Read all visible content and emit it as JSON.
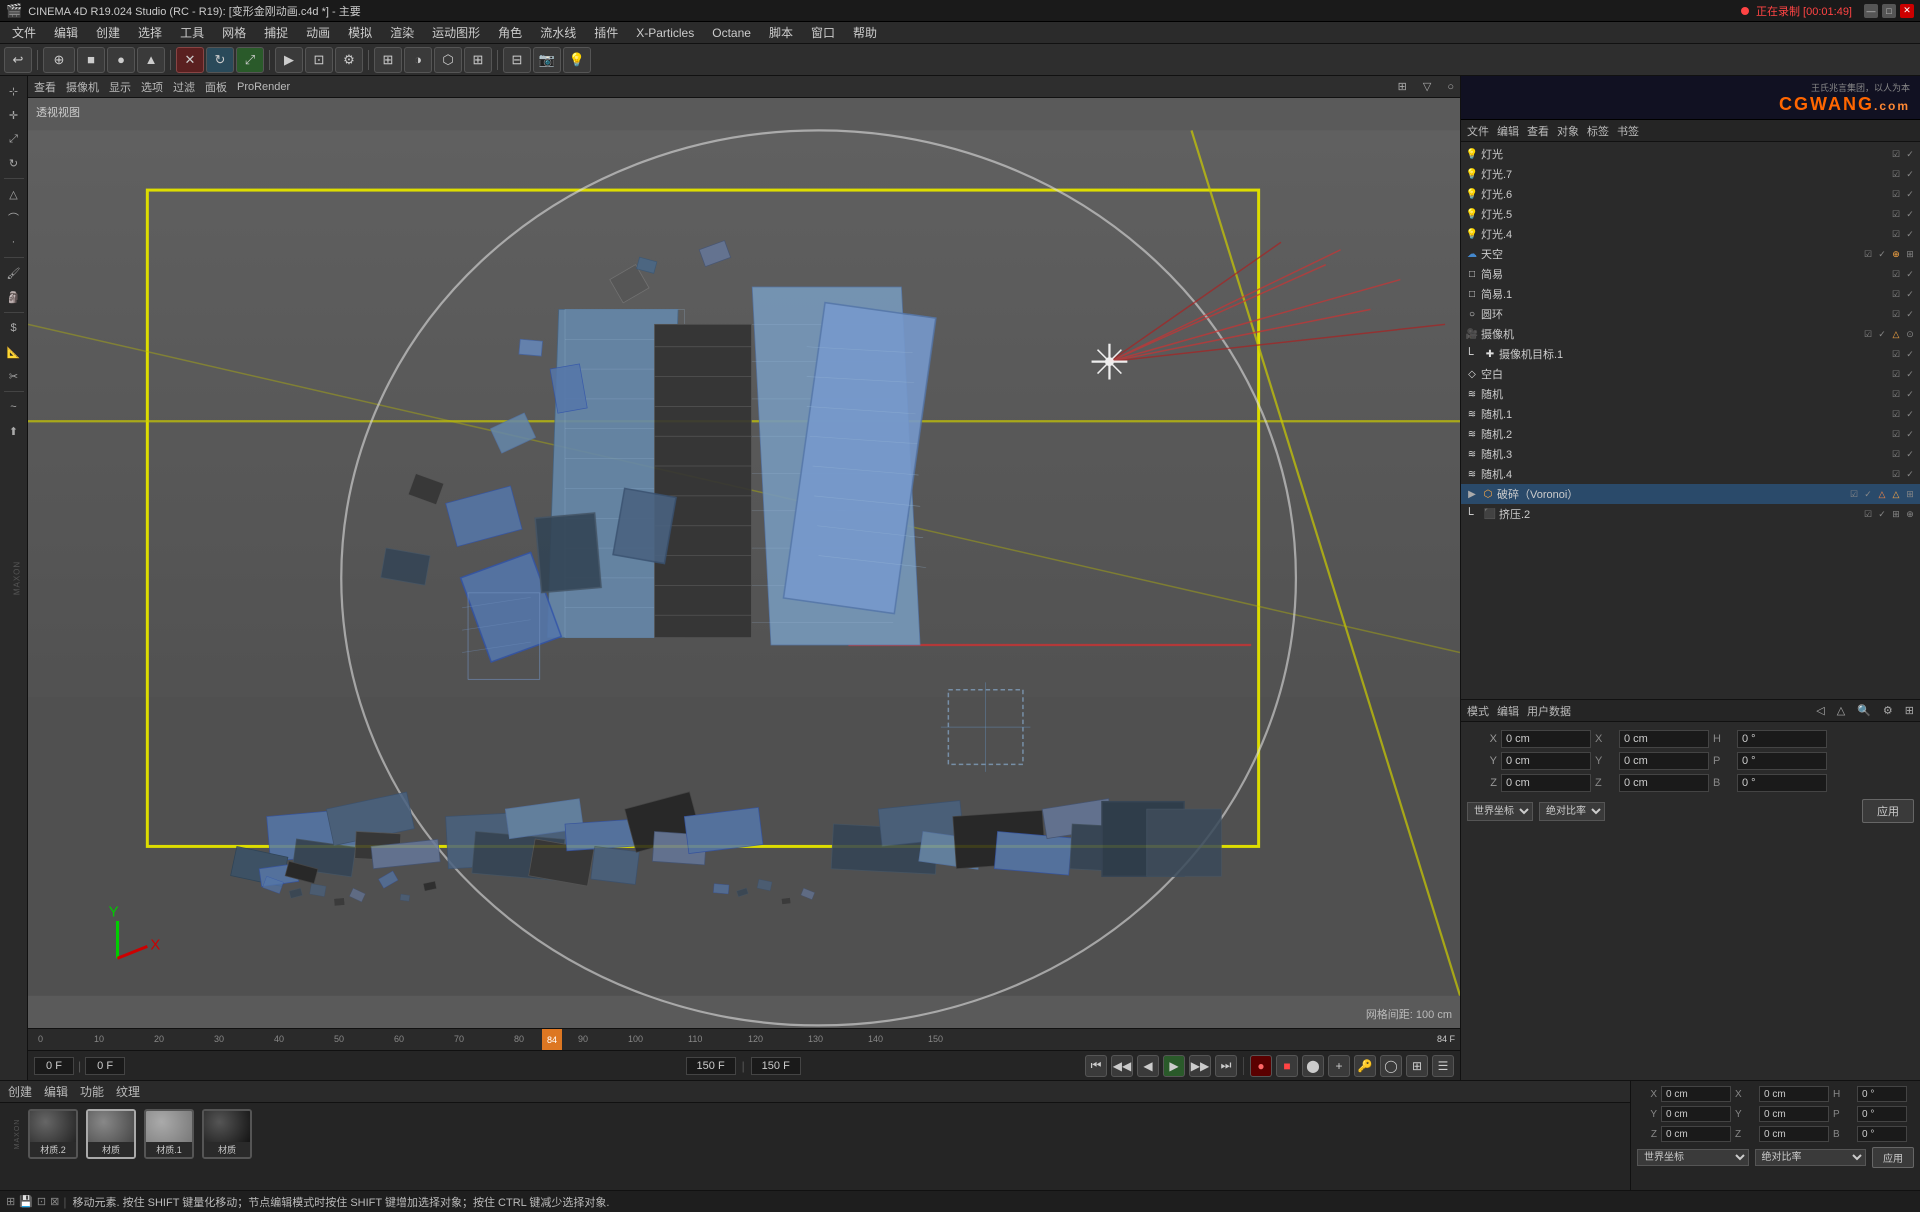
{
  "titleBar": {
    "title": "CINEMA 4D R19.024 Studio (RC - R19): [变形金刚动画.c4d *] - 主要",
    "recording": "正在录制 [00:01:49]"
  },
  "menuBar": {
    "items": [
      "文件",
      "编辑",
      "创建",
      "选择",
      "工具",
      "网格",
      "捕捉",
      "动画",
      "模拟",
      "渲染",
      "运动图形",
      "角色",
      "流水线",
      "插件",
      "X-Particles",
      "Octane",
      "脚本",
      "窗口",
      "帮助"
    ]
  },
  "viewportToolbar": {
    "items": [
      "查看",
      "摄像机",
      "显示",
      "选项",
      "过滤",
      "面板",
      "ProRender"
    ]
  },
  "viewport": {
    "label": "透视视图",
    "gridInfo": "网格间距: 100 cm"
  },
  "objectManager": {
    "toolbarItems": [
      "文件",
      "编辑",
      "查看",
      "对象",
      "标签",
      "书签"
    ],
    "objects": [
      {
        "name": "灯光",
        "indent": 0,
        "icon": "💡",
        "color": "#ffaa00",
        "vis": true,
        "lock": true
      },
      {
        "name": "灯光.7",
        "indent": 0,
        "icon": "💡",
        "color": "#ffaa00",
        "vis": true,
        "lock": true
      },
      {
        "name": "灯光.6",
        "indent": 0,
        "icon": "💡",
        "color": "#ffaa00",
        "vis": true,
        "lock": true
      },
      {
        "name": "灯光.5",
        "indent": 0,
        "icon": "💡",
        "color": "#ffaa00",
        "vis": true,
        "lock": true
      },
      {
        "name": "灯光.4",
        "indent": 0,
        "icon": "💡",
        "color": "#ffaa00",
        "vis": true,
        "lock": true
      },
      {
        "name": "天空",
        "indent": 0,
        "icon": "☁",
        "color": "#4488cc",
        "vis": true,
        "lock": true
      },
      {
        "name": "简易",
        "indent": 0,
        "icon": "□",
        "color": "#aaaaaa",
        "vis": true,
        "lock": true
      },
      {
        "name": "简易.1",
        "indent": 0,
        "icon": "□",
        "color": "#aaaaaa",
        "vis": true,
        "lock": true
      },
      {
        "name": "圆环",
        "indent": 0,
        "icon": "○",
        "color": "#aaaaaa",
        "vis": true,
        "lock": true
      },
      {
        "name": "摄像机",
        "indent": 0,
        "icon": "🎥",
        "color": "#aaaaaa",
        "vis": true,
        "lock": true,
        "active": true
      },
      {
        "name": "摄像机目标.1",
        "indent": 1,
        "icon": "✚",
        "color": "#aaaaaa",
        "vis": true,
        "lock": true
      },
      {
        "name": "空白",
        "indent": 0,
        "icon": "◇",
        "color": "#aaaaaa",
        "vis": true,
        "lock": true
      },
      {
        "name": "随机",
        "indent": 0,
        "icon": "≋",
        "color": "#aaaaaa",
        "vis": true,
        "lock": true
      },
      {
        "name": "随机.1",
        "indent": 0,
        "icon": "≋",
        "color": "#aaaaaa",
        "vis": true,
        "lock": true
      },
      {
        "name": "随机.2",
        "indent": 0,
        "icon": "≋",
        "color": "#aaaaaa",
        "vis": true,
        "lock": true
      },
      {
        "name": "随机.3",
        "indent": 0,
        "icon": "≋",
        "color": "#aaaaaa",
        "vis": true,
        "lock": true
      },
      {
        "name": "随机.4",
        "indent": 0,
        "icon": "≋",
        "color": "#aaaaaa",
        "vis": true,
        "lock": true
      },
      {
        "name": "破碎（Voronoi）",
        "indent": 0,
        "icon": "⬡",
        "color": "#ffaa44",
        "vis": true,
        "lock": true,
        "selected": true
      },
      {
        "name": "挤压.2",
        "indent": 1,
        "icon": "⬛",
        "color": "#aaaaaa",
        "vis": true,
        "lock": true
      }
    ]
  },
  "attrPanel": {
    "toolbarItems": [
      "模式",
      "编辑",
      "用户数据"
    ],
    "coords": {
      "x_pos": "0 cm",
      "y_pos": "0 cm",
      "z_pos": "0 cm",
      "x_rot": "0 cm",
      "y_rot": "0 cm",
      "z_rot": "0 cm",
      "h": "0 °",
      "p": "0 °",
      "b": "0 °",
      "worldLabel": "世界坐标",
      "objectLabel": "绝对比率",
      "applyLabel": "应用"
    }
  },
  "timeline": {
    "currentFrame": "84",
    "totalFrames": "150 F",
    "startFrame": "0 F",
    "endFrame": "150 F",
    "frameDisplay": "84 F",
    "ticks": [
      0,
      10,
      20,
      30,
      40,
      50,
      60,
      70,
      80,
      90,
      100,
      110,
      120,
      130,
      140,
      150
    ]
  },
  "transport": {
    "startField": "0 F",
    "currentField": "0 F",
    "endField": "150 F",
    "totalField": "150 F"
  },
  "materials": [
    {
      "name": "材质.2",
      "type": "metal_dark",
      "selected": false
    },
    {
      "name": "材质",
      "type": "metal_mid",
      "selected": true
    },
    {
      "name": "材质.1",
      "type": "metal_light",
      "selected": false
    },
    {
      "name": "材质",
      "type": "black",
      "selected": false
    }
  ],
  "statusBar": {
    "text": "移动元素. 按住 SHIFT 键量化移动；节点编辑模式时按住 SHIFT 键增加选择对象；按住 CTRL 键减少选择对象."
  },
  "bottomTabs": {
    "items": [
      "创建",
      "编辑",
      "功能",
      "纹理"
    ]
  },
  "logo": {
    "top": "王氏兆言集团，以人为本",
    "brand": "CGWANG",
    "sub": ".com"
  }
}
